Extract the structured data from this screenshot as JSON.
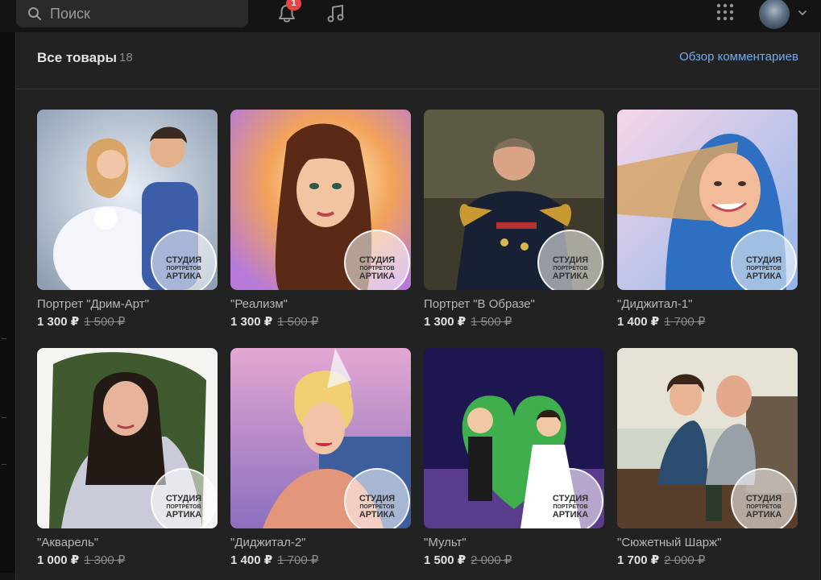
{
  "search": {
    "placeholder": "Поиск"
  },
  "notifications": {
    "count": "1"
  },
  "section": {
    "title": "Все товары",
    "count": "18",
    "link": "Обзор комментариев"
  },
  "stamp": {
    "line1": "СТУДИЯ",
    "line2": "ПОРТРЕТОВ",
    "line3": "АРТИКА"
  },
  "products": [
    {
      "name": "Портрет \"Дрим-Арт\"",
      "price": "1 300 ₽",
      "old_price": "1 500 ₽"
    },
    {
      "name": "\"Реализм\"",
      "price": "1 300 ₽",
      "old_price": "1 500 ₽"
    },
    {
      "name": "Портрет \"В Образе\"",
      "price": "1 300 ₽",
      "old_price": "1 500 ₽"
    },
    {
      "name": "\"Диджитал-1\"",
      "price": "1 400 ₽",
      "old_price": "1 700 ₽"
    },
    {
      "name": "\"Акварель\"",
      "price": "1 000 ₽",
      "old_price": "1 300 ₽"
    },
    {
      "name": "\"Диджитал-2\"",
      "price": "1 400 ₽",
      "old_price": "1 700 ₽"
    },
    {
      "name": "\"Мульт\"",
      "price": "1 500 ₽",
      "old_price": "2 000 ₽"
    },
    {
      "name": "\"Сюжетный Шарж\"",
      "price": "1 700 ₽",
      "old_price": "2 000 ₽"
    }
  ],
  "colors": {
    "background": "#141414",
    "panel": "#222222",
    "accent_link": "#71aaeb",
    "badge": "#e64646"
  }
}
